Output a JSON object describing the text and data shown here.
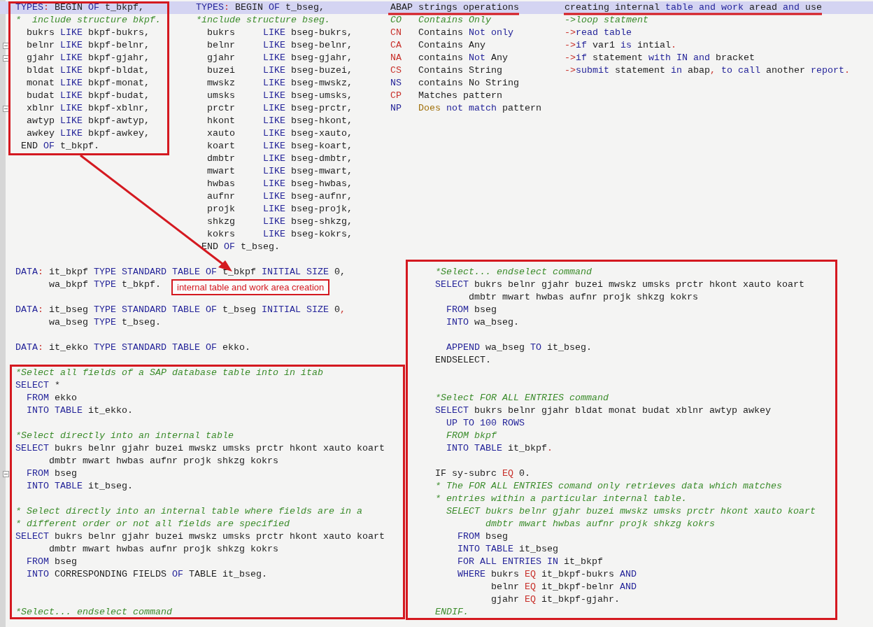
{
  "editor": {
    "top_columns": [
      {
        "lines": [
          {
            "kind": "code",
            "highlighted": true,
            "segments": [
              {
                "kind": "kw",
                "text": "TYPES"
              },
              {
                "kind": "op",
                "text": ":"
              },
              {
                "kind": "tx",
                "text": " BEGIN "
              },
              {
                "kind": "kw",
                "text": "OF"
              },
              {
                "kind": "tx",
                "text": " t_bkpf,"
              }
            ]
          },
          {
            "kind": "code",
            "segments": [
              {
                "kind": "cm",
                "text": "*  include structure bkpf."
              }
            ]
          },
          {
            "kind": "code",
            "segments": [
              {
                "kind": "tx",
                "text": "  bukrs "
              },
              {
                "kind": "kw",
                "text": "LIKE"
              },
              {
                "kind": "tx",
                "text": " bkpf-bukrs,"
              }
            ]
          },
          {
            "kind": "code",
            "fold": true,
            "segments": [
              {
                "kind": "tx",
                "text": "  belnr "
              },
              {
                "kind": "kw",
                "text": "LIKE"
              },
              {
                "kind": "tx",
                "text": " bkpf-belnr,"
              }
            ]
          },
          {
            "kind": "code",
            "fold": true,
            "segments": [
              {
                "kind": "tx",
                "text": "  gjahr "
              },
              {
                "kind": "kw",
                "text": "LIKE"
              },
              {
                "kind": "tx",
                "text": " bkpf-gjahr,"
              }
            ]
          },
          {
            "kind": "code",
            "segments": [
              {
                "kind": "tx",
                "text": "  bldat "
              },
              {
                "kind": "kw",
                "text": "LIKE"
              },
              {
                "kind": "tx",
                "text": " bkpf-bldat,"
              }
            ]
          },
          {
            "kind": "code",
            "segments": [
              {
                "kind": "tx",
                "text": "  monat "
              },
              {
                "kind": "kw",
                "text": "LIKE"
              },
              {
                "kind": "tx",
                "text": " bkpf-monat,"
              }
            ]
          },
          {
            "kind": "code",
            "segments": [
              {
                "kind": "tx",
                "text": "  budat "
              },
              {
                "kind": "kw",
                "text": "LIKE"
              },
              {
                "kind": "tx",
                "text": " bkpf-budat,"
              }
            ]
          },
          {
            "kind": "code",
            "fold": true,
            "segments": [
              {
                "kind": "tx",
                "text": "  xblnr "
              },
              {
                "kind": "kw",
                "text": "LIKE"
              },
              {
                "kind": "tx",
                "text": " bkpf-xblnr,"
              }
            ]
          },
          {
            "kind": "code",
            "segments": [
              {
                "kind": "tx",
                "text": "  awtyp "
              },
              {
                "kind": "kw",
                "text": "LIKE"
              },
              {
                "kind": "tx",
                "text": " bkpf-awtyp,"
              }
            ]
          },
          {
            "kind": "code",
            "segments": [
              {
                "kind": "tx",
                "text": "  awkey "
              },
              {
                "kind": "kw",
                "text": "LIKE"
              },
              {
                "kind": "tx",
                "text": " bkpf-awkey,"
              }
            ]
          },
          {
            "kind": "code",
            "segments": [
              {
                "kind": "tx",
                "text": " END "
              },
              {
                "kind": "kw",
                "text": "OF"
              },
              {
                "kind": "tx",
                "text": " t_bkpf."
              }
            ]
          }
        ]
      },
      {
        "lines": [
          {
            "kind": "code",
            "highlighted": true,
            "segments": [
              {
                "kind": "kw",
                "text": "TYPES"
              },
              {
                "kind": "op",
                "text": ":"
              },
              {
                "kind": "tx",
                "text": " BEGIN "
              },
              {
                "kind": "kw",
                "text": "OF"
              },
              {
                "kind": "tx",
                "text": " t_bseg,"
              }
            ]
          },
          {
            "kind": "code",
            "segments": [
              {
                "kind": "cm",
                "text": "*include structure bseg."
              }
            ]
          },
          {
            "kind": "code",
            "segments": [
              {
                "kind": "tx",
                "text": "  bukrs     "
              },
              {
                "kind": "kw",
                "text": "LIKE"
              },
              {
                "kind": "tx",
                "text": " bseg-bukrs,"
              }
            ]
          },
          {
            "kind": "code",
            "segments": [
              {
                "kind": "tx",
                "text": "  belnr     "
              },
              {
                "kind": "kw",
                "text": "LIKE"
              },
              {
                "kind": "tx",
                "text": " bseg-belnr,"
              }
            ]
          },
          {
            "kind": "code",
            "segments": [
              {
                "kind": "tx",
                "text": "  gjahr     "
              },
              {
                "kind": "kw",
                "text": "LIKE"
              },
              {
                "kind": "tx",
                "text": " bseg-gjahr,"
              }
            ]
          },
          {
            "kind": "code",
            "segments": [
              {
                "kind": "tx",
                "text": "  buzei     "
              },
              {
                "kind": "kw",
                "text": "LIKE"
              },
              {
                "kind": "tx",
                "text": " bseg-buzei,"
              }
            ]
          },
          {
            "kind": "code",
            "segments": [
              {
                "kind": "tx",
                "text": "  mwskz     "
              },
              {
                "kind": "kw",
                "text": "LIKE"
              },
              {
                "kind": "tx",
                "text": " bseg-mwskz,"
              }
            ]
          },
          {
            "kind": "code",
            "segments": [
              {
                "kind": "tx",
                "text": "  umsks     "
              },
              {
                "kind": "kw",
                "text": "LIKE"
              },
              {
                "kind": "tx",
                "text": " bseg-umsks,"
              }
            ]
          },
          {
            "kind": "code",
            "segments": [
              {
                "kind": "tx",
                "text": "  prctr     "
              },
              {
                "kind": "kw",
                "text": "LIKE"
              },
              {
                "kind": "tx",
                "text": " bseg-prctr,"
              }
            ]
          },
          {
            "kind": "code",
            "segments": [
              {
                "kind": "tx",
                "text": "  hkont     "
              },
              {
                "kind": "kw",
                "text": "LIKE"
              },
              {
                "kind": "tx",
                "text": " bseg-hkont,"
              }
            ]
          },
          {
            "kind": "code",
            "segments": [
              {
                "kind": "tx",
                "text": "  xauto     "
              },
              {
                "kind": "kw",
                "text": "LIKE"
              },
              {
                "kind": "tx",
                "text": " bseg-xauto,"
              }
            ]
          },
          {
            "kind": "code",
            "segments": [
              {
                "kind": "tx",
                "text": "  koart     "
              },
              {
                "kind": "kw",
                "text": "LIKE"
              },
              {
                "kind": "tx",
                "text": " bseg-koart,"
              }
            ]
          },
          {
            "kind": "code",
            "segments": [
              {
                "kind": "tx",
                "text": "  dmbtr     "
              },
              {
                "kind": "kw",
                "text": "LIKE"
              },
              {
                "kind": "tx",
                "text": " bseg-dmbtr,"
              }
            ]
          },
          {
            "kind": "code",
            "segments": [
              {
                "kind": "tx",
                "text": "  mwart     "
              },
              {
                "kind": "kw",
                "text": "LIKE"
              },
              {
                "kind": "tx",
                "text": " bseg-mwart,"
              }
            ]
          },
          {
            "kind": "code",
            "segments": [
              {
                "kind": "tx",
                "text": "  hwbas     "
              },
              {
                "kind": "kw",
                "text": "LIKE"
              },
              {
                "kind": "tx",
                "text": " bseg-hwbas,"
              }
            ]
          },
          {
            "kind": "code",
            "segments": [
              {
                "kind": "tx",
                "text": "  aufnr     "
              },
              {
                "kind": "kw",
                "text": "LIKE"
              },
              {
                "kind": "tx",
                "text": " bseg-aufnr,"
              }
            ]
          },
          {
            "kind": "code",
            "segments": [
              {
                "kind": "tx",
                "text": "  projk     "
              },
              {
                "kind": "kw",
                "text": "LIKE"
              },
              {
                "kind": "tx",
                "text": " bseg-projk,"
              }
            ]
          },
          {
            "kind": "code",
            "segments": [
              {
                "kind": "tx",
                "text": "  shkzg     "
              },
              {
                "kind": "kw",
                "text": "LIKE"
              },
              {
                "kind": "tx",
                "text": " bseg-shkzg,"
              }
            ]
          },
          {
            "kind": "code",
            "segments": [
              {
                "kind": "tx",
                "text": "  kokrs     "
              },
              {
                "kind": "kw",
                "text": "LIKE"
              },
              {
                "kind": "tx",
                "text": " bseg-kokrs,"
              }
            ]
          },
          {
            "kind": "code",
            "segments": [
              {
                "kind": "tx",
                "text": " END "
              },
              {
                "kind": "kw",
                "text": "OF"
              },
              {
                "kind": "tx",
                "text": " t_bseg."
              }
            ]
          }
        ]
      },
      {
        "lines": [
          {
            "kind": "code",
            "highlighted": true,
            "segments": [
              {
                "kind": "tx",
                "text": "ABAP strings operations"
              }
            ]
          },
          {
            "kind": "code",
            "segments": [
              {
                "kind": "cm",
                "text": "CO   Contains Only"
              }
            ]
          },
          {
            "kind": "code",
            "segments": [
              {
                "kind": "op",
                "text": "CN"
              },
              {
                "kind": "tx",
                "text": "   Contains "
              },
              {
                "kind": "kw",
                "text": "Not only"
              }
            ]
          },
          {
            "kind": "code",
            "segments": [
              {
                "kind": "op",
                "text": "CA"
              },
              {
                "kind": "tx",
                "text": "   Contains Any"
              }
            ]
          },
          {
            "kind": "code",
            "segments": [
              {
                "kind": "op",
                "text": "NA"
              },
              {
                "kind": "tx",
                "text": "   contains "
              },
              {
                "kind": "kw",
                "text": "Not"
              },
              {
                "kind": "tx",
                "text": " Any"
              }
            ]
          },
          {
            "kind": "code",
            "segments": [
              {
                "kind": "op",
                "text": "CS"
              },
              {
                "kind": "tx",
                "text": "   Contains String"
              }
            ]
          },
          {
            "kind": "code",
            "segments": [
              {
                "kind": "kw",
                "text": "NS"
              },
              {
                "kind": "tx",
                "text": "   contains No String"
              }
            ]
          },
          {
            "kind": "code",
            "segments": [
              {
                "kind": "op",
                "text": "CP"
              },
              {
                "kind": "tx",
                "text": "   Matches pattern"
              }
            ]
          },
          {
            "kind": "code",
            "segments": [
              {
                "kind": "kw",
                "text": "NP"
              },
              {
                "kind": "br",
                "text": "   Does"
              },
              {
                "kind": "kw",
                "text": " not match"
              },
              {
                "kind": "tx",
                "text": " pattern"
              }
            ]
          }
        ]
      },
      {
        "lines": [
          {
            "kind": "code",
            "highlighted": true,
            "segments": [
              {
                "kind": "tx",
                "text": "creating internal "
              },
              {
                "kind": "kw",
                "text": "table and work"
              },
              {
                "kind": "tx",
                "text": " aread "
              },
              {
                "kind": "kw",
                "text": "and"
              },
              {
                "kind": "tx",
                "text": " use"
              }
            ]
          },
          {
            "kind": "code",
            "segments": [
              {
                "kind": "cm",
                "text": "->loop statment"
              }
            ]
          },
          {
            "kind": "code",
            "segments": [
              {
                "kind": "op",
                "text": "->"
              },
              {
                "kind": "kw",
                "text": "read table"
              }
            ]
          },
          {
            "kind": "code",
            "segments": [
              {
                "kind": "op",
                "text": "->"
              },
              {
                "kind": "kw",
                "text": "if"
              },
              {
                "kind": "tx",
                "text": " var1 "
              },
              {
                "kind": "kw",
                "text": "is"
              },
              {
                "kind": "tx",
                "text": " intial"
              },
              {
                "kind": "op",
                "text": "."
              }
            ]
          },
          {
            "kind": "code",
            "segments": [
              {
                "kind": "op",
                "text": "->"
              },
              {
                "kind": "kw",
                "text": "if"
              },
              {
                "kind": "tx",
                "text": " statement "
              },
              {
                "kind": "kw",
                "text": "with IN and"
              },
              {
                "kind": "tx",
                "text": " bracket"
              }
            ]
          },
          {
            "kind": "code",
            "segments": [
              {
                "kind": "op",
                "text": "->"
              },
              {
                "kind": "kw",
                "text": "submit"
              },
              {
                "kind": "tx",
                "text": " statement "
              },
              {
                "kind": "kw",
                "text": "in"
              },
              {
                "kind": "tx",
                "text": " abap"
              },
              {
                "kind": "op",
                "text": ","
              },
              {
                "kind": "kw",
                "text": " to call"
              },
              {
                "kind": "tx",
                "text": " another "
              },
              {
                "kind": "kw",
                "text": "report"
              },
              {
                "kind": "op",
                "text": "."
              }
            ]
          }
        ]
      }
    ],
    "bottom_columns": [
      {
        "lines": [
          {
            "kind": "code",
            "segments": [
              {
                "kind": "kw",
                "text": "DATA"
              },
              {
                "kind": "op",
                "text": ":"
              },
              {
                "kind": "tx",
                "text": " it_bkpf "
              },
              {
                "kind": "kw",
                "text": "TYPE STANDARD TABLE OF"
              },
              {
                "kind": "tx",
                "text": " t_bkpf "
              },
              {
                "kind": "kw",
                "text": "INITIAL SIZE"
              },
              {
                "kind": "tx",
                "text": " 0,"
              }
            ]
          },
          {
            "kind": "code",
            "segments": [
              {
                "kind": "tx",
                "text": "      wa_bkpf "
              },
              {
                "kind": "kw",
                "text": "TYPE"
              },
              {
                "kind": "tx",
                "text": " t_bkpf."
              }
            ]
          },
          {
            "kind": "blank"
          },
          {
            "kind": "code",
            "segments": [
              {
                "kind": "kw",
                "text": "DATA"
              },
              {
                "kind": "op",
                "text": ":"
              },
              {
                "kind": "tx",
                "text": " it_bseg "
              },
              {
                "kind": "kw",
                "text": "TYPE STANDARD TABLE OF"
              },
              {
                "kind": "tx",
                "text": " t_bseg "
              },
              {
                "kind": "kw",
                "text": "INITIAL SIZE"
              },
              {
                "kind": "tx",
                "text": " 0"
              },
              {
                "kind": "op",
                "text": ","
              }
            ]
          },
          {
            "kind": "code",
            "segments": [
              {
                "kind": "tx",
                "text": "      wa_bseg "
              },
              {
                "kind": "kw",
                "text": "TYPE"
              },
              {
                "kind": "tx",
                "text": " t_bseg."
              }
            ]
          },
          {
            "kind": "blank"
          },
          {
            "kind": "code",
            "segments": [
              {
                "kind": "kw",
                "text": "DATA"
              },
              {
                "kind": "op",
                "text": ":"
              },
              {
                "kind": "tx",
                "text": " it_ekko "
              },
              {
                "kind": "kw",
                "text": "TYPE STANDARD TABLE OF"
              },
              {
                "kind": "tx",
                "text": " ekko."
              }
            ]
          },
          {
            "kind": "blank"
          },
          {
            "kind": "code",
            "segments": [
              {
                "kind": "cm",
                "text": "*Select all fields of a SAP database table into in itab"
              }
            ]
          },
          {
            "kind": "code",
            "segments": [
              {
                "kind": "kw",
                "text": "SELECT"
              },
              {
                "kind": "tx",
                "text": " *"
              }
            ]
          },
          {
            "kind": "code",
            "segments": [
              {
                "kind": "kw",
                "text": "  FROM"
              },
              {
                "kind": "tx",
                "text": " ekko"
              }
            ]
          },
          {
            "kind": "code",
            "segments": [
              {
                "kind": "kw",
                "text": "  INTO TABLE"
              },
              {
                "kind": "tx",
                "text": " it_ekko."
              }
            ]
          },
          {
            "kind": "blank"
          },
          {
            "kind": "code",
            "segments": [
              {
                "kind": "cm",
                "text": "*Select directly into an internal table"
              }
            ]
          },
          {
            "kind": "code",
            "segments": [
              {
                "kind": "kw",
                "text": "SELECT"
              },
              {
                "kind": "tx",
                "text": " bukrs belnr gjahr buzei mwskz umsks prctr hkont xauto koart"
              }
            ]
          },
          {
            "kind": "code",
            "segments": [
              {
                "kind": "tx",
                "text": "      dmbtr mwart hwbas aufnr projk shkzg kokrs"
              }
            ]
          },
          {
            "kind": "code",
            "fold": true,
            "segments": [
              {
                "kind": "kw",
                "text": "  FROM"
              },
              {
                "kind": "tx",
                "text": " bseg"
              }
            ]
          },
          {
            "kind": "code",
            "segments": [
              {
                "kind": "kw",
                "text": "  INTO TABLE"
              },
              {
                "kind": "tx",
                "text": " it_bseg."
              }
            ]
          },
          {
            "kind": "blank"
          },
          {
            "kind": "code",
            "segments": [
              {
                "kind": "cm",
                "text": "* Select directly into an internal table where fields are in a"
              }
            ]
          },
          {
            "kind": "code",
            "segments": [
              {
                "kind": "cm",
                "text": "* different order or not all fields are specified"
              }
            ]
          },
          {
            "kind": "code",
            "segments": [
              {
                "kind": "kw",
                "text": "SELECT"
              },
              {
                "kind": "tx",
                "text": " bukrs belnr gjahr buzei mwskz umsks prctr hkont xauto koart"
              }
            ]
          },
          {
            "kind": "code",
            "segments": [
              {
                "kind": "tx",
                "text": "      dmbtr mwart hwbas aufnr projk shkzg kokrs"
              }
            ]
          },
          {
            "kind": "code",
            "segments": [
              {
                "kind": "kw",
                "text": "  FROM"
              },
              {
                "kind": "tx",
                "text": " bseg"
              }
            ]
          },
          {
            "kind": "code",
            "segments": [
              {
                "kind": "kw",
                "text": "  INTO"
              },
              {
                "kind": "tx",
                "text": " CORRESPONDING FIELDS "
              },
              {
                "kind": "kw",
                "text": "OF"
              },
              {
                "kind": "tx",
                "text": " TABLE it_bseg."
              }
            ]
          },
          {
            "kind": "blank"
          },
          {
            "kind": "blank"
          },
          {
            "kind": "code",
            "segments": [
              {
                "kind": "cm",
                "text": "*Select... endselect command"
              }
            ]
          }
        ]
      },
      {
        "lines": [
          {
            "kind": "code",
            "segments": [
              {
                "kind": "cm",
                "text": "*Select... endselect command"
              }
            ]
          },
          {
            "kind": "code",
            "segments": [
              {
                "kind": "kw",
                "text": "SELECT"
              },
              {
                "kind": "tx",
                "text": " bukrs belnr gjahr buzei mwskz umsks prctr hkont xauto koart"
              }
            ]
          },
          {
            "kind": "code",
            "segments": [
              {
                "kind": "tx",
                "text": "      dmbtr mwart hwbas aufnr projk shkzg kokrs"
              }
            ]
          },
          {
            "kind": "code",
            "segments": [
              {
                "kind": "kw",
                "text": "  FROM"
              },
              {
                "kind": "tx",
                "text": " bseg"
              }
            ]
          },
          {
            "kind": "code",
            "segments": [
              {
                "kind": "kw",
                "text": "  INTO"
              },
              {
                "kind": "tx",
                "text": " wa_bseg."
              }
            ]
          },
          {
            "kind": "blank"
          },
          {
            "kind": "code",
            "segments": [
              {
                "kind": "kw",
                "text": "  APPEND"
              },
              {
                "kind": "tx",
                "text": " wa_bseg "
              },
              {
                "kind": "kw",
                "text": "TO"
              },
              {
                "kind": "tx",
                "text": " it_bseg."
              }
            ]
          },
          {
            "kind": "code",
            "segments": [
              {
                "kind": "tx",
                "text": "ENDSELECT."
              }
            ]
          },
          {
            "kind": "blank"
          },
          {
            "kind": "blank"
          },
          {
            "kind": "code",
            "segments": [
              {
                "kind": "cm",
                "text": "*Select FOR ALL ENTRIES command"
              }
            ]
          },
          {
            "kind": "code",
            "segments": [
              {
                "kind": "kw",
                "text": "SELECT"
              },
              {
                "kind": "tx",
                "text": " bukrs belnr gjahr bldat monat budat xblnr awtyp awkey"
              }
            ]
          },
          {
            "kind": "code",
            "segments": [
              {
                "kind": "kw",
                "text": "  UP TO 100 ROWS"
              }
            ]
          },
          {
            "kind": "code",
            "segments": [
              {
                "kind": "cm",
                "text": "  FROM bkpf"
              }
            ]
          },
          {
            "kind": "code",
            "segments": [
              {
                "kind": "kw",
                "text": "  INTO TABLE"
              },
              {
                "kind": "tx",
                "text": " it_bkpf"
              },
              {
                "kind": "op",
                "text": "."
              }
            ]
          },
          {
            "kind": "blank"
          },
          {
            "kind": "code",
            "segments": [
              {
                "kind": "tx",
                "text": "IF sy-subrc "
              },
              {
                "kind": "op",
                "text": "EQ"
              },
              {
                "kind": "tx",
                "text": " 0."
              }
            ]
          },
          {
            "kind": "code",
            "segments": [
              {
                "kind": "cm",
                "text": "* The FOR ALL ENTRIES comand only retrieves data which matches"
              }
            ]
          },
          {
            "kind": "code",
            "segments": [
              {
                "kind": "cm",
                "text": "* entries within a particular internal table."
              }
            ]
          },
          {
            "kind": "code",
            "segments": [
              {
                "kind": "cm",
                "text": "  SELECT bukrs belnr gjahr buzei mwskz umsks prctr hkont xauto koart"
              }
            ]
          },
          {
            "kind": "code",
            "segments": [
              {
                "kind": "cm",
                "text": "         dmbtr mwart hwbas aufnr projk shkzg kokrs"
              }
            ]
          },
          {
            "kind": "code",
            "segments": [
              {
                "kind": "kw",
                "text": "    FROM"
              },
              {
                "kind": "tx",
                "text": " bseg"
              }
            ]
          },
          {
            "kind": "code",
            "segments": [
              {
                "kind": "kw",
                "text": "    INTO TABLE"
              },
              {
                "kind": "tx",
                "text": " it_bseg"
              }
            ]
          },
          {
            "kind": "code",
            "segments": [
              {
                "kind": "kw",
                "text": "    FOR ALL ENTRIES IN"
              },
              {
                "kind": "tx",
                "text": " it_bkpf"
              }
            ]
          },
          {
            "kind": "code",
            "segments": [
              {
                "kind": "kw",
                "text": "    WHERE"
              },
              {
                "kind": "tx",
                "text": " bukrs "
              },
              {
                "kind": "op",
                "text": "EQ"
              },
              {
                "kind": "tx",
                "text": " it_bkpf-bukrs "
              },
              {
                "kind": "kw",
                "text": "AND"
              }
            ]
          },
          {
            "kind": "code",
            "segments": [
              {
                "kind": "tx",
                "text": "          belnr "
              },
              {
                "kind": "op",
                "text": "EQ"
              },
              {
                "kind": "tx",
                "text": " it_bkpf-belnr "
              },
              {
                "kind": "kw",
                "text": "AND"
              }
            ]
          },
          {
            "kind": "code",
            "segments": [
              {
                "kind": "tx",
                "text": "          gjahr "
              },
              {
                "kind": "op",
                "text": "EQ"
              },
              {
                "kind": "tx",
                "text": " it_bkpf-gjahr."
              }
            ]
          },
          {
            "kind": "code",
            "segments": [
              {
                "kind": "cm",
                "text": "ENDIF."
              }
            ]
          }
        ]
      }
    ]
  },
  "annotations": {
    "callout": "internal table and work area creation"
  }
}
